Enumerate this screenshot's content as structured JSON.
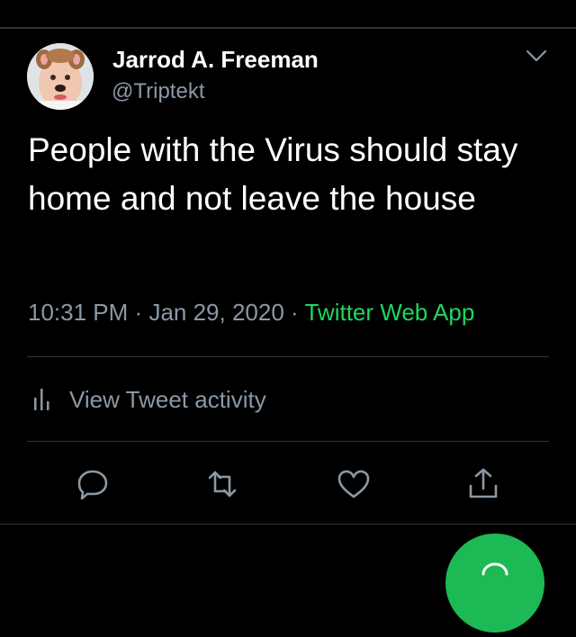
{
  "tweet": {
    "author_name": "Jarrod A. Freeman",
    "author_handle": "@Triptekt",
    "text": "People with the Virus should stay home and not leave the house",
    "time": "10:31 PM",
    "separator": "·",
    "date": "Jan 29, 2020",
    "source": "Twitter Web App"
  },
  "activity": {
    "label": "View Tweet activity"
  },
  "actions": {
    "reply_icon": "reply-icon",
    "retweet_icon": "retweet-icon",
    "like_icon": "heart-icon",
    "share_icon": "share-icon"
  },
  "colors": {
    "background": "#000000",
    "text": "#ffffff",
    "secondary_text": "#8b98a5",
    "accent": "#1ed760",
    "divider": "#2f3336",
    "fab": "#1db954"
  }
}
